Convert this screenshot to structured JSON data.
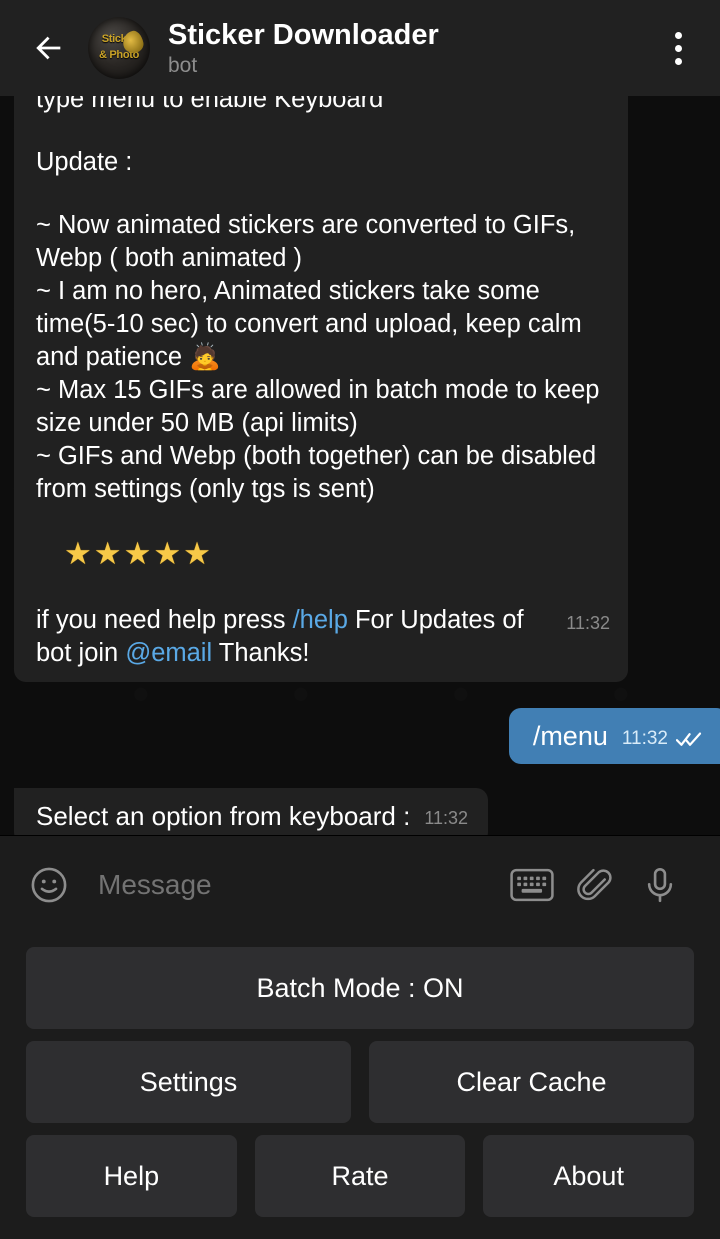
{
  "header": {
    "back_icon": "back-arrow-icon",
    "title": "Sticker Downloader",
    "subtitle": "bot",
    "avatar_line1": "Sticker",
    "avatar_line2": "& Photo",
    "menu_icon": "overflow-menu-icon"
  },
  "chat": {
    "message_bot": {
      "clipped_top_line": "type menu to enable Keyboard",
      "update_heading": "Update :",
      "bullets": [
        "~ Now animated stickers are converted to GIFs, Webp ( both animated )",
        "~ I am no hero, Animated stickers take some time(5-10 sec) to convert and upload, keep calm and patience 🙇",
        "~ Max 15 GIFs are allowed in batch mode to keep size under 50 MB (api limits)",
        "~ GIFs and Webp (both together) can be disabled from settings (only tgs is sent)"
      ],
      "stars": "★★★★★",
      "footer_prefix": "if you need help press ",
      "footer_link1": "/help",
      "footer_middle": " For Updates of bot join ",
      "footer_link2": "@email",
      "footer_suffix": " Thanks!",
      "time": "11:32"
    },
    "message_user": {
      "text": "/menu",
      "time": "11:32",
      "status_icon": "double-check-icon"
    },
    "message_bot2": {
      "text": "Select an option from keyboard :",
      "time": "11:32"
    }
  },
  "input_bar": {
    "emoji_icon": "smiley-face-icon",
    "placeholder": "Message",
    "keyboard_icon": "keyboard-icon",
    "attach_icon": "paperclip-icon",
    "voice_icon": "microphone-icon"
  },
  "reply_keyboard": {
    "rows": [
      [
        "Batch Mode : ON"
      ],
      [
        "Settings",
        "Clear Cache"
      ],
      [
        "Help",
        "Rate",
        "About"
      ]
    ]
  },
  "colors": {
    "header_bg": "#212121",
    "chat_bg": "#0d0d0d",
    "bubble_in": "#212121",
    "bubble_out": "#417fb4",
    "link": "#5aa9e6",
    "keyboard_bg": "#1c1c1c",
    "keyboard_button": "#2e2e30",
    "star": "#f7c948"
  }
}
